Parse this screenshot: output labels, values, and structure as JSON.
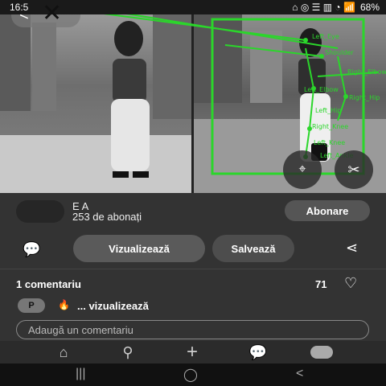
{
  "status_bar": {
    "time": "16:5",
    "battery": "68%",
    "icons": "⌂ ◎ ☰ ▥ ◔ 📶"
  },
  "photo": {
    "back_glyph": "<",
    "close_glyph": "✕",
    "more_glyph": "•••",
    "lens_glyph": "⌖",
    "cut_glyph": "✂",
    "keypoint_labels": [
      "Left_Eye",
      "Shoulder",
      "Right_Elbow",
      "Left_Elbow",
      "Right_Hip",
      "Left_Hip",
      "Right_Knee",
      "Left_Knee",
      "Left_Ankle"
    ],
    "overlay_color": "#2bd62b"
  },
  "creator": {
    "name": "E A",
    "followers": "253 de abonați",
    "follow_label": "Abonare"
  },
  "actions": {
    "visit_label": "Vizualizează",
    "save_label": "Salvează",
    "comment_glyph": "💬",
    "share_glyph": "⋖"
  },
  "comments": {
    "title": "1 comentariu",
    "likes": "71",
    "heart_glyph": "♡",
    "items": [
      {
        "avatar": "P",
        "icon": "🔥",
        "text": "... vizualizează"
      }
    ],
    "input_placeholder": "Adaugă un comentariu"
  },
  "bottom_nav": {
    "items": [
      {
        "name": "home",
        "glyph": "⌂"
      },
      {
        "name": "search",
        "glyph": "⚲"
      },
      {
        "name": "create",
        "glyph": "+"
      },
      {
        "name": "messages",
        "glyph": "💬"
      }
    ]
  },
  "system_nav": {
    "recents": "|||",
    "home": "◯",
    "back": "<"
  }
}
